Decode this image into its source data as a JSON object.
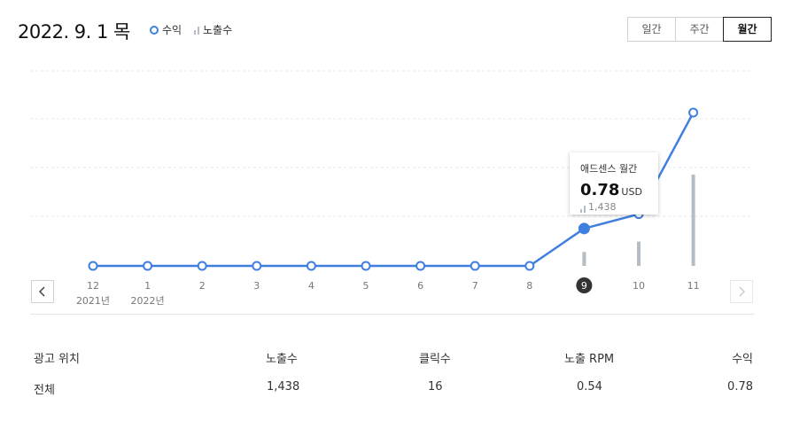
{
  "header": {
    "date": "2022. 9. 1 목",
    "legend": {
      "revenue": "수익",
      "impressions": "노출수"
    },
    "period_tabs": [
      {
        "label": "일간",
        "active": false
      },
      {
        "label": "주간",
        "active": false
      },
      {
        "label": "월간",
        "active": true
      }
    ]
  },
  "chart_data": {
    "type": "line",
    "categories": [
      "12",
      "1",
      "2",
      "3",
      "4",
      "5",
      "6",
      "7",
      "8",
      "9",
      "10",
      "11"
    ],
    "year_labels": {
      "12": "2021년",
      "1": "2022년"
    },
    "selected_category": "9",
    "series": [
      {
        "name": "수익",
        "type": "line",
        "color": "#3f7fe0",
        "values": [
          0,
          0,
          0,
          0,
          0,
          0,
          0,
          0,
          0,
          0.78,
          1.08,
          3.2
        ]
      },
      {
        "name": "노출수",
        "type": "bar",
        "color": "#b4bcc4",
        "values": [
          0,
          0,
          0,
          0,
          0,
          0,
          0,
          0,
          0,
          1438,
          2500,
          9400
        ]
      }
    ],
    "grid": true,
    "legend": "top"
  },
  "tooltip": {
    "title": "애드센스 월간",
    "value": "0.78",
    "unit": "USD",
    "impressions": "1,438"
  },
  "table": {
    "headers": [
      "광고 위치",
      "노출수",
      "클릭수",
      "노출 RPM",
      "수익"
    ],
    "rows": [
      [
        "전체",
        "1,438",
        "16",
        "0.54",
        "0.78"
      ]
    ]
  },
  "colors": {
    "accent": "#3f7fe0",
    "bar": "#b4bcc4",
    "grid": "#e3e5e8"
  }
}
